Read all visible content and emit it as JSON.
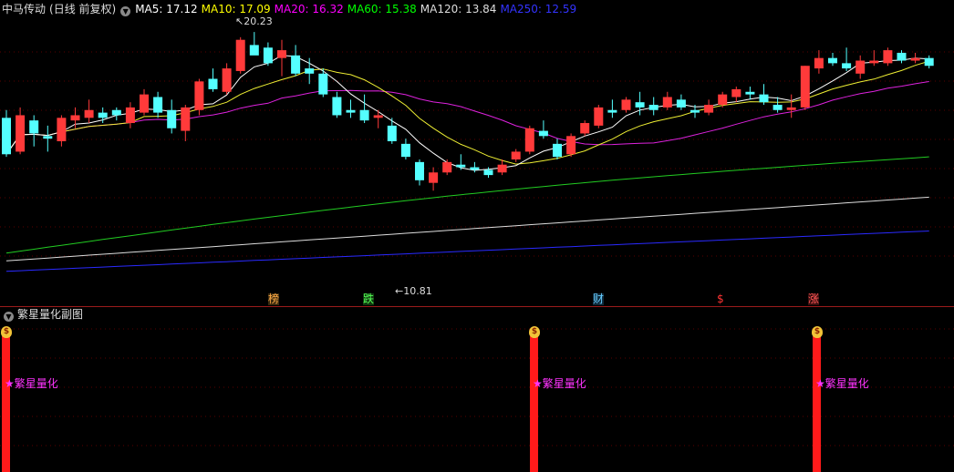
{
  "header": {
    "stock_name": "中马传动",
    "period": "(日线 前复权)",
    "indicators": [
      {
        "label": "MA5: 17.12",
        "color": "#ffffff"
      },
      {
        "label": "MA10: 17.09",
        "color": "#ffff00"
      },
      {
        "label": "MA20: 16.32",
        "color": "#ff00ff"
      },
      {
        "label": "MA60: 15.38",
        "color": "#00ff00"
      },
      {
        "label": "MA120: 13.84",
        "color": "#dddddd"
      },
      {
        "label": "MA250: 12.59",
        "color": "#3333ff"
      }
    ]
  },
  "main_chart": {
    "high_label": "20.23",
    "low_label": "10.81",
    "markers": [
      {
        "text": "榜",
        "color": "#ffaa44"
      },
      {
        "text": "跌",
        "color": "#55ff55"
      },
      {
        "text": "财",
        "color": "#66ccff"
      },
      {
        "text": "$",
        "color": "#ff3333"
      },
      {
        "text": "涨",
        "color": "#ff5555"
      }
    ]
  },
  "sub_chart": {
    "title": "繁星量化副图",
    "signal_label": "繁星量化",
    "signal_color": "#ff33ff",
    "bar_color": "#ff1a1a"
  },
  "chart_data": {
    "type": "candlestick",
    "ohlc": [
      [
        16.9,
        17.2,
        15.4,
        15.5
      ],
      [
        15.6,
        17.3,
        15.5,
        17.0
      ],
      [
        16.8,
        17.0,
        15.8,
        16.3
      ],
      [
        16.2,
        16.6,
        15.6,
        16.1
      ],
      [
        16.0,
        17.0,
        15.8,
        16.9
      ],
      [
        16.8,
        17.3,
        16.5,
        17.0
      ],
      [
        16.9,
        17.6,
        16.7,
        17.2
      ],
      [
        17.1,
        17.3,
        16.7,
        16.9
      ],
      [
        17.2,
        17.3,
        16.8,
        17.0
      ],
      [
        16.7,
        17.5,
        16.5,
        17.3
      ],
      [
        17.1,
        18.0,
        17.0,
        17.8
      ],
      [
        17.7,
        17.9,
        16.9,
        17.1
      ],
      [
        17.2,
        17.6,
        16.3,
        16.5
      ],
      [
        16.4,
        17.4,
        16.0,
        17.3
      ],
      [
        17.2,
        18.4,
        17.0,
        18.3
      ],
      [
        18.4,
        18.8,
        17.9,
        18.0
      ],
      [
        17.9,
        19.0,
        17.8,
        18.8
      ],
      [
        18.7,
        20.0,
        18.6,
        19.9
      ],
      [
        19.7,
        20.2,
        19.5,
        19.3
      ],
      [
        19.6,
        19.8,
        18.9,
        19.0
      ],
      [
        19.2,
        19.9,
        18.5,
        19.5
      ],
      [
        19.3,
        19.7,
        18.5,
        18.6
      ],
      [
        18.8,
        19.2,
        18.2,
        18.6
      ],
      [
        18.6,
        18.8,
        17.7,
        17.8
      ],
      [
        17.7,
        17.9,
        16.9,
        17.0
      ],
      [
        17.2,
        17.6,
        16.9,
        17.1
      ],
      [
        17.2,
        17.8,
        16.7,
        16.8
      ],
      [
        16.9,
        17.2,
        16.5,
        17.0
      ],
      [
        16.6,
        16.9,
        15.9,
        16.0
      ],
      [
        15.9,
        16.1,
        15.3,
        15.4
      ],
      [
        15.2,
        15.3,
        14.3,
        14.5
      ],
      [
        14.4,
        15.0,
        14.1,
        14.8
      ],
      [
        14.8,
        15.3,
        14.7,
        15.2
      ],
      [
        15.1,
        15.5,
        14.9,
        15.0
      ],
      [
        15.0,
        15.2,
        14.8,
        14.9
      ],
      [
        14.9,
        15.0,
        14.6,
        14.7
      ],
      [
        14.8,
        15.3,
        14.7,
        15.1
      ],
      [
        15.3,
        15.7,
        15.2,
        15.6
      ],
      [
        15.6,
        16.6,
        15.5,
        16.5
      ],
      [
        16.4,
        16.8,
        16.1,
        16.2
      ],
      [
        15.9,
        16.1,
        15.3,
        15.4
      ],
      [
        15.5,
        16.3,
        15.4,
        16.2
      ],
      [
        16.3,
        16.8,
        16.2,
        16.7
      ],
      [
        16.6,
        17.4,
        16.5,
        17.3
      ],
      [
        17.2,
        17.6,
        16.9,
        17.1
      ],
      [
        17.2,
        17.7,
        17.1,
        17.6
      ],
      [
        17.5,
        17.9,
        17.0,
        17.3
      ],
      [
        17.4,
        17.7,
        17.0,
        17.2
      ],
      [
        17.3,
        17.9,
        17.2,
        17.7
      ],
      [
        17.6,
        17.8,
        17.2,
        17.3
      ],
      [
        17.2,
        17.4,
        16.9,
        17.1
      ],
      [
        17.1,
        17.6,
        17.0,
        17.4
      ],
      [
        17.4,
        17.9,
        17.3,
        17.8
      ],
      [
        17.7,
        18.1,
        17.5,
        18.0
      ],
      [
        17.9,
        18.1,
        17.6,
        17.8
      ],
      [
        17.8,
        18.2,
        17.4,
        17.5
      ],
      [
        17.4,
        17.7,
        17.1,
        17.2
      ],
      [
        17.2,
        17.8,
        16.9,
        17.3
      ],
      [
        17.3,
        18.9,
        17.2,
        18.9
      ],
      [
        18.8,
        19.5,
        18.6,
        19.2
      ],
      [
        19.2,
        19.4,
        18.9,
        19.0
      ],
      [
        19.0,
        19.6,
        18.7,
        18.8
      ],
      [
        18.6,
        19.3,
        18.4,
        19.1
      ],
      [
        19.0,
        19.5,
        18.9,
        19.1
      ],
      [
        19.0,
        19.6,
        18.9,
        19.5
      ],
      [
        19.4,
        19.5,
        19.0,
        19.1
      ],
      [
        19.1,
        19.4,
        19.0,
        19.2
      ],
      [
        19.2,
        19.3,
        18.8,
        18.9
      ]
    ],
    "price_range": [
      10.5,
      20.8
    ],
    "indicators_unit": "price"
  }
}
